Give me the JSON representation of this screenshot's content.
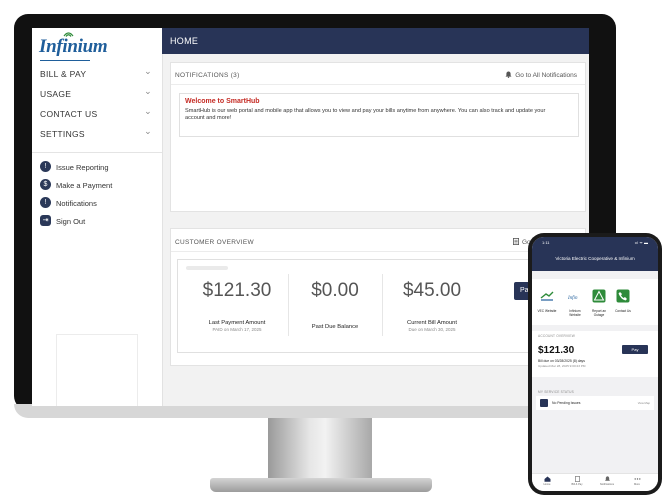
{
  "brand": {
    "logo_text": "Infinium",
    "primary": "#283457",
    "logo_blue": "#1f5e9b",
    "alert_red": "#c42a23",
    "green": "#2e8b3a"
  },
  "sidebar": {
    "menu": [
      {
        "label": "BILL & PAY"
      },
      {
        "label": "USAGE"
      },
      {
        "label": "CONTACT US"
      },
      {
        "label": "SETTINGS"
      }
    ],
    "chevron": "⌄",
    "quick_links": [
      {
        "label": "Issue Reporting",
        "icon": "exclamation-icon",
        "glyph": "!"
      },
      {
        "label": "Make a Payment",
        "icon": "dollar-icon",
        "glyph": "$"
      },
      {
        "label": "Notifications",
        "icon": "bell-icon",
        "glyph": "!"
      },
      {
        "label": "Sign Out",
        "icon": "sign-out-icon",
        "glyph": "⇥"
      }
    ]
  },
  "header": {
    "title": "HOME"
  },
  "notifications": {
    "title": "NOTIFICATIONS (3)",
    "link": "Go to All Notifications",
    "welcome_title": "Welcome to SmartHub",
    "welcome_text": "SmartHub is our web portal and mobile app that allows you to view and pay your bills anytime from anywhere. You can also track and update your account and more!"
  },
  "overview": {
    "title": "CUSTOMER OVERVIEW",
    "link": "Go T",
    "last_payment": {
      "amount": "$121.30",
      "label": "Last Payment Amount",
      "sub": "PAID on March 17, 2025"
    },
    "past_due": {
      "amount": "$0.00",
      "label": "Past Due Balance"
    },
    "current_bill": {
      "amount": "$45.00",
      "label": "Current Bill Amount",
      "sub": "Due on March 30, 2025"
    },
    "pay_label": "Pay"
  },
  "phone": {
    "time": "1:11",
    "signal": "•ıl ᯤ ▬",
    "title": "Victoria Electric Cooperative & Infinium",
    "quick": [
      {
        "label": "VEC Website",
        "icon": "vec-logo-icon"
      },
      {
        "label": "Infinium Website",
        "icon": "infinium-logo-icon"
      },
      {
        "label": "Report an Outage",
        "icon": "report-outage-icon"
      },
      {
        "label": "Contact Us",
        "icon": "contact-us-icon"
      }
    ],
    "account_title": "ACCOUNT OVERVIEW",
    "amount": "$121.30",
    "due": "Bill due on 03/28/2025 (8) days",
    "updated": "Updated Mar 28, 2025 9:00:23 PM",
    "pay_label": "Pay",
    "service_title": "MY SERVICE STATUS",
    "service_item": "No Pending Issues",
    "service_more": "View Map",
    "tabs": [
      {
        "label": "Home",
        "icon": "home-icon"
      },
      {
        "label": "Bill & Pay",
        "icon": "bill-icon"
      },
      {
        "label": "Notifications",
        "icon": "bell-icon"
      },
      {
        "label": "More",
        "icon": "more-icon"
      }
    ]
  }
}
